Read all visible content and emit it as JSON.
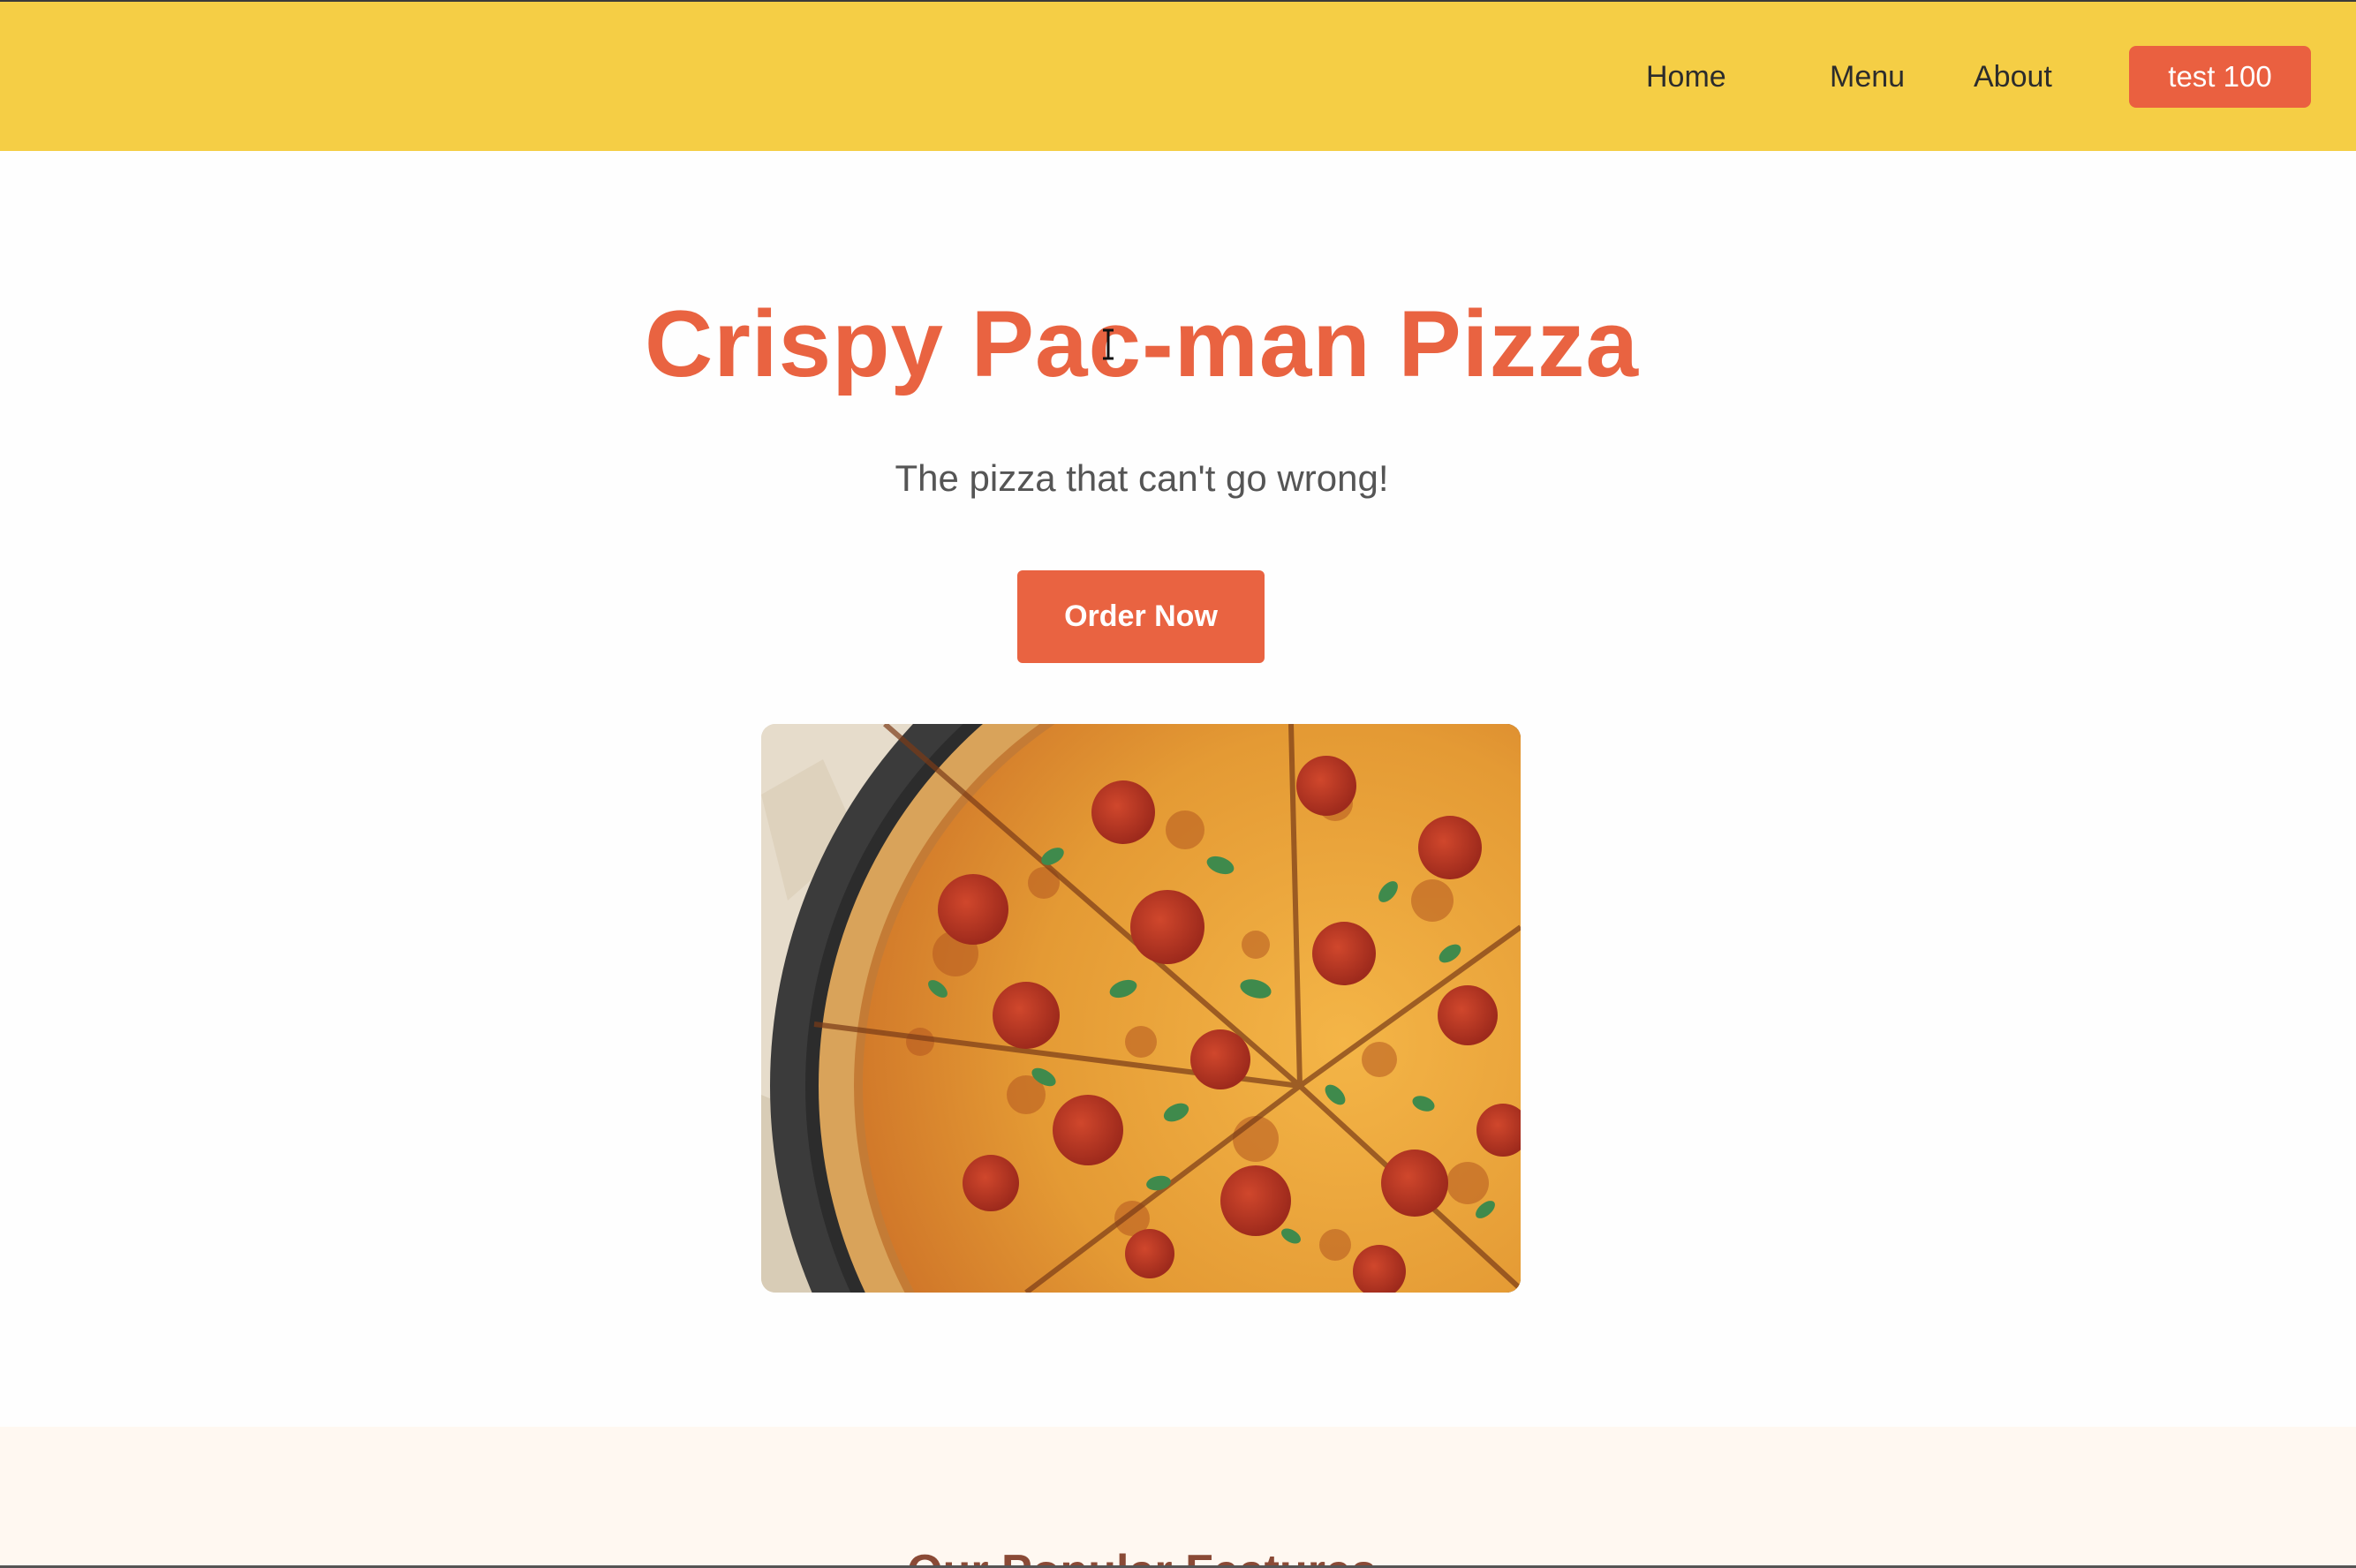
{
  "header": {
    "nav": {
      "home": "Home",
      "menu": "Menu",
      "about": "About",
      "cta": "test 100"
    }
  },
  "hero": {
    "title": "Crispy Pac-man Pizza",
    "subtitle": "The pizza that can't go wrong!",
    "order_button": "Order Now"
  },
  "features": {
    "heading": "Our Popular Features"
  },
  "colors": {
    "header_background": "#f5ce45",
    "accent": "#e96341",
    "features_background": "#fff8f1"
  }
}
